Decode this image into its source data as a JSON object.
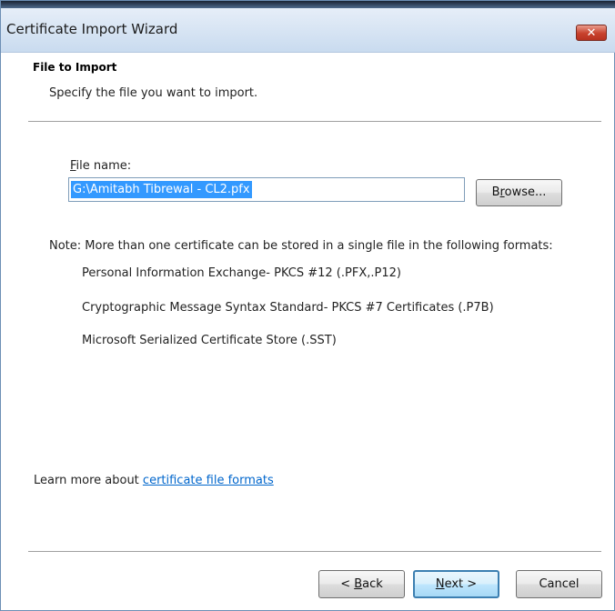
{
  "window": {
    "title": "Certificate Import Wizard",
    "close_symbol": "✕"
  },
  "header": {
    "title": "File to Import",
    "subtitle": "Specify the file you want to import."
  },
  "file": {
    "label_mnemonic": "F",
    "label_rest": "ile name:",
    "value": "G:\\Amitabh Tibrewal - CL2.pfx"
  },
  "browse": {
    "pre": "B",
    "mnemonic": "r",
    "post": "owse..."
  },
  "note": "Note:  More than one certificate can be stored in a single file in the following formats:",
  "formats": [
    "Personal Information Exchange- PKCS #12 (.PFX,.P12)",
    "Cryptographic Message Syntax Standard- PKCS #7 Certificates (.P7B)",
    "Microsoft Serialized Certificate Store (.SST)"
  ],
  "learn_more": {
    "prefix": "Learn more about ",
    "link": "certificate file formats"
  },
  "buttons": {
    "back_pre": "< ",
    "back_mnemonic": "B",
    "back_post": "ack",
    "next_mnemonic": "N",
    "next_post": "ext >",
    "cancel": "Cancel"
  },
  "colors": {
    "selection": "#3399ff",
    "link": "#0066cc",
    "close_button": "#c8412c"
  },
  "icons": [
    "close-icon"
  ]
}
